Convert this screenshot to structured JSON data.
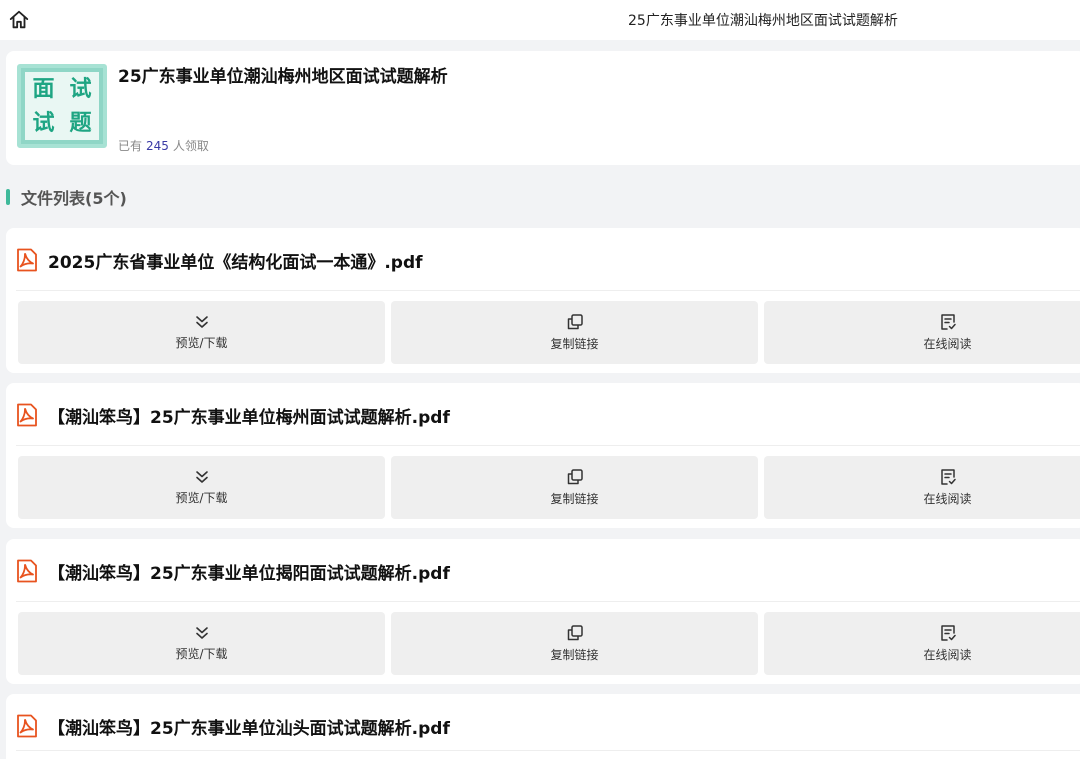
{
  "topbar": {
    "title": "25广东事业单位潮汕梅州地区面试试题解析",
    "home_icon": "home-icon"
  },
  "header": {
    "cover_chars": [
      "面",
      "试",
      "试",
      "题"
    ],
    "title": "25广东事业单位潮汕梅州地区面试试题解析",
    "claim_prefix": "已有",
    "claim_count": "245",
    "claim_suffix": "人领取"
  },
  "section": {
    "title": "文件列表(5个)"
  },
  "colors": {
    "accent": "#3fb99a",
    "pdf": "#e8531f",
    "count": "#3a3aa5"
  },
  "actions": {
    "download": "预览/下载",
    "copy": "复制链接",
    "read": "在线阅读"
  },
  "files": [
    {
      "name": "2025广东省事业单位《结构化面试一本通》.pdf"
    },
    {
      "name": "【潮汕笨鸟】25广东事业单位梅州面试试题解析.pdf"
    },
    {
      "name": "【潮汕笨鸟】25广东事业单位揭阳面试试题解析.pdf"
    },
    {
      "name": "【潮汕笨鸟】25广东事业单位汕头面试试题解析.pdf"
    }
  ]
}
